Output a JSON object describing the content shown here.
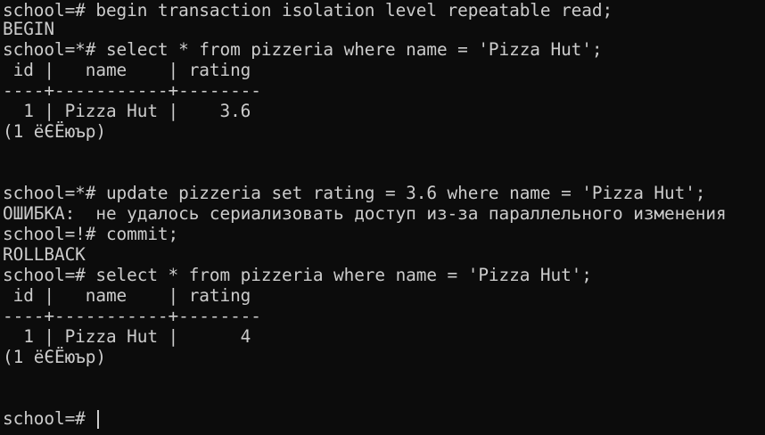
{
  "terminal": {
    "lines": [
      "school=# begin transaction isolation level repeatable read;",
      "BEGIN",
      "school=*# select * from pizzeria where name = 'Pizza Hut';",
      " id |   name    | rating",
      "----+-----------+--------",
      "  1 | Pizza Hut |    3.6",
      "(1 ёЄЁюър)",
      "",
      "",
      "school=*# update pizzeria set rating = 3.6 where name = 'Pizza Hut';",
      "ОШИБКА:  не удалось сериализовать доступ из-за параллельного изменения",
      "school=!# commit;",
      "ROLLBACK",
      "school=# select * from pizzeria where name = 'Pizza Hut';",
      " id |   name    | rating",
      "----+-----------+--------",
      "  1 | Pizza Hut |      4",
      "(1 ёЄЁюър)",
      "",
      "",
      "school=# "
    ]
  }
}
